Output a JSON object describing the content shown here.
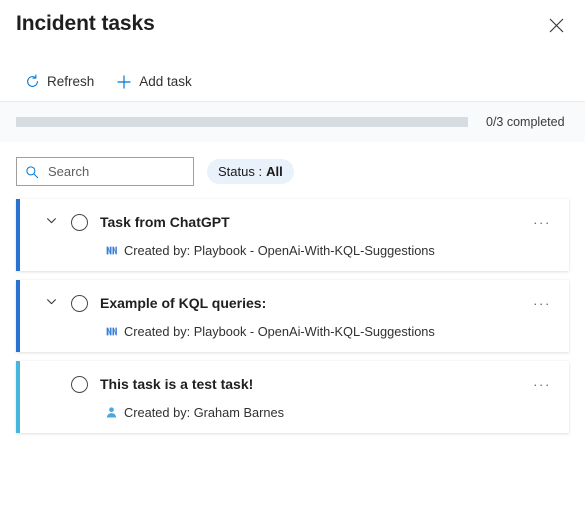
{
  "header": {
    "title": "Incident tasks",
    "close_icon": "close-icon"
  },
  "command_bar": {
    "refresh": {
      "label": "Refresh",
      "icon": "refresh-icon"
    },
    "add_task": {
      "label": "Add task",
      "icon": "plus-icon"
    }
  },
  "progress": {
    "percent": 0,
    "label": "0/3 completed",
    "track_color": "#d7dbe2",
    "fill_color": "#0078d4"
  },
  "filters": {
    "search": {
      "placeholder": "Search",
      "value": "",
      "icon": "search-icon"
    },
    "status_filter": {
      "label": "Status :",
      "value": "All",
      "background": "#e9f1fb"
    }
  },
  "tasks": [
    {
      "title": "Task from ChatGPT",
      "expandable": true,
      "chevron": "chevron-down-icon",
      "completed": false,
      "accent_color": "#2a72d0",
      "creator_icon": "playbook-icon",
      "creator_text": "Created by: Playbook - OpenAi-With-KQL-Suggestions",
      "more_label": "···"
    },
    {
      "title": "Example of KQL queries:",
      "expandable": true,
      "chevron": "chevron-down-icon",
      "completed": false,
      "accent_color": "#2a72d0",
      "creator_icon": "playbook-icon",
      "creator_text": "Created by: Playbook - OpenAi-With-KQL-Suggestions",
      "more_label": "···"
    },
    {
      "title": "This task is a test task!",
      "expandable": false,
      "chevron": "",
      "completed": false,
      "accent_color": "#45b6dd",
      "creator_icon": "person-icon",
      "creator_text": "Created by: Graham Barnes",
      "more_label": "···"
    }
  ]
}
